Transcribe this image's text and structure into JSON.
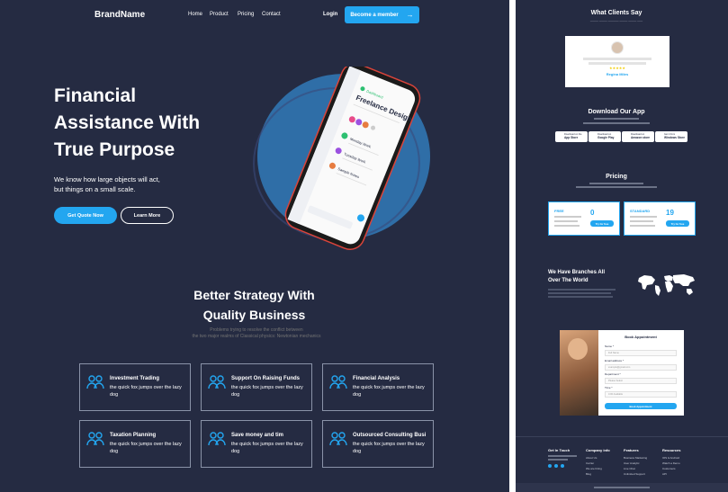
{
  "header": {
    "brand": "BrandName",
    "nav": [
      "Home",
      "Product",
      "Pricing",
      "Contact"
    ],
    "login": "Login",
    "cta": "Become a member",
    "cta_arrow": "→"
  },
  "hero": {
    "title_lines": [
      "Financial",
      "Assistance With",
      "True Purpose"
    ],
    "desc_lines": [
      "We know how large objects will act,",
      "but things on a small scale."
    ],
    "primary_btn": "Get Quote Now",
    "secondary_btn": "Learn More",
    "phone": {
      "heading": "Freelance Design",
      "items": [
        "Monday Work",
        "Tuesday Work",
        "Sample Notes"
      ]
    }
  },
  "strategy": {
    "title_lines": [
      "Better Strategy With",
      "Quality Business"
    ],
    "sub_lines": [
      "Problems trying to resolve the conflict between",
      "the two major realms of Classical physics: Newtonian mechanics"
    ]
  },
  "services": [
    {
      "title": "Investment Trading",
      "desc": "the quick fox jumps over the lazy dog"
    },
    {
      "title": "Support On Raising Funds",
      "desc": "the quick fox jumps over the lazy dog"
    },
    {
      "title": "Financial Analysis",
      "desc": "the quick fox jumps over the lazy dog"
    },
    {
      "title": "Taxation Planning",
      "desc": "the quick fox jumps over the lazy dog"
    },
    {
      "title": "Save money and tim",
      "desc": "the quick fox jumps over the lazy dog"
    },
    {
      "title": "Outsourced Consulting Busi",
      "desc": "the quick fox jumps over the lazy dog"
    }
  ],
  "right": {
    "clients_title": "What Clients Say",
    "testimonial_name": "Regina Miles",
    "testimonial_stars": "★★★★★",
    "app_title": "Download Our App",
    "stores": [
      {
        "top": "Download on the",
        "name": "App Store"
      },
      {
        "top": "Download on",
        "name": "Google Play"
      },
      {
        "top": "Download on",
        "name": "Amazon store"
      },
      {
        "top": "Get it from",
        "name": "Windows Store"
      }
    ],
    "pricing_title": "Pricing",
    "plans": [
      {
        "name": "FREE",
        "price": "0",
        "btn": "Try for free"
      },
      {
        "name": "STANDARD",
        "price": "19",
        "btn": "Try for free"
      }
    ],
    "branches_title_lines": [
      "We Have Branches All",
      "Over The World"
    ],
    "appointment_title": "Book Appointment",
    "form": [
      {
        "label": "Name *",
        "placeholder": "Full Name"
      },
      {
        "label": "Email address *",
        "placeholder": "example@gmail.com"
      },
      {
        "label": "Department *",
        "placeholder": "Please Select"
      },
      {
        "label": "Time *",
        "placeholder": "4:00 Available"
      }
    ],
    "form_btn": "Book Appointment",
    "footer": [
      {
        "h": "Get In Touch",
        "items": []
      },
      {
        "h": "Company info",
        "items": [
          "About Us",
          "Carrier",
          "We are hiring",
          "Blog"
        ]
      },
      {
        "h": "Features",
        "items": [
          "Business Marketing",
          "User Analytic",
          "Live Chat",
          "Unlimited Support"
        ]
      },
      {
        "h": "Resources",
        "items": [
          "IOS & Android",
          "Watch a Demo",
          "Customers",
          "API"
        ]
      }
    ]
  },
  "colors": {
    "bg": "#252b42",
    "accent": "#23a6f0",
    "blob": "#2f6ea7"
  }
}
